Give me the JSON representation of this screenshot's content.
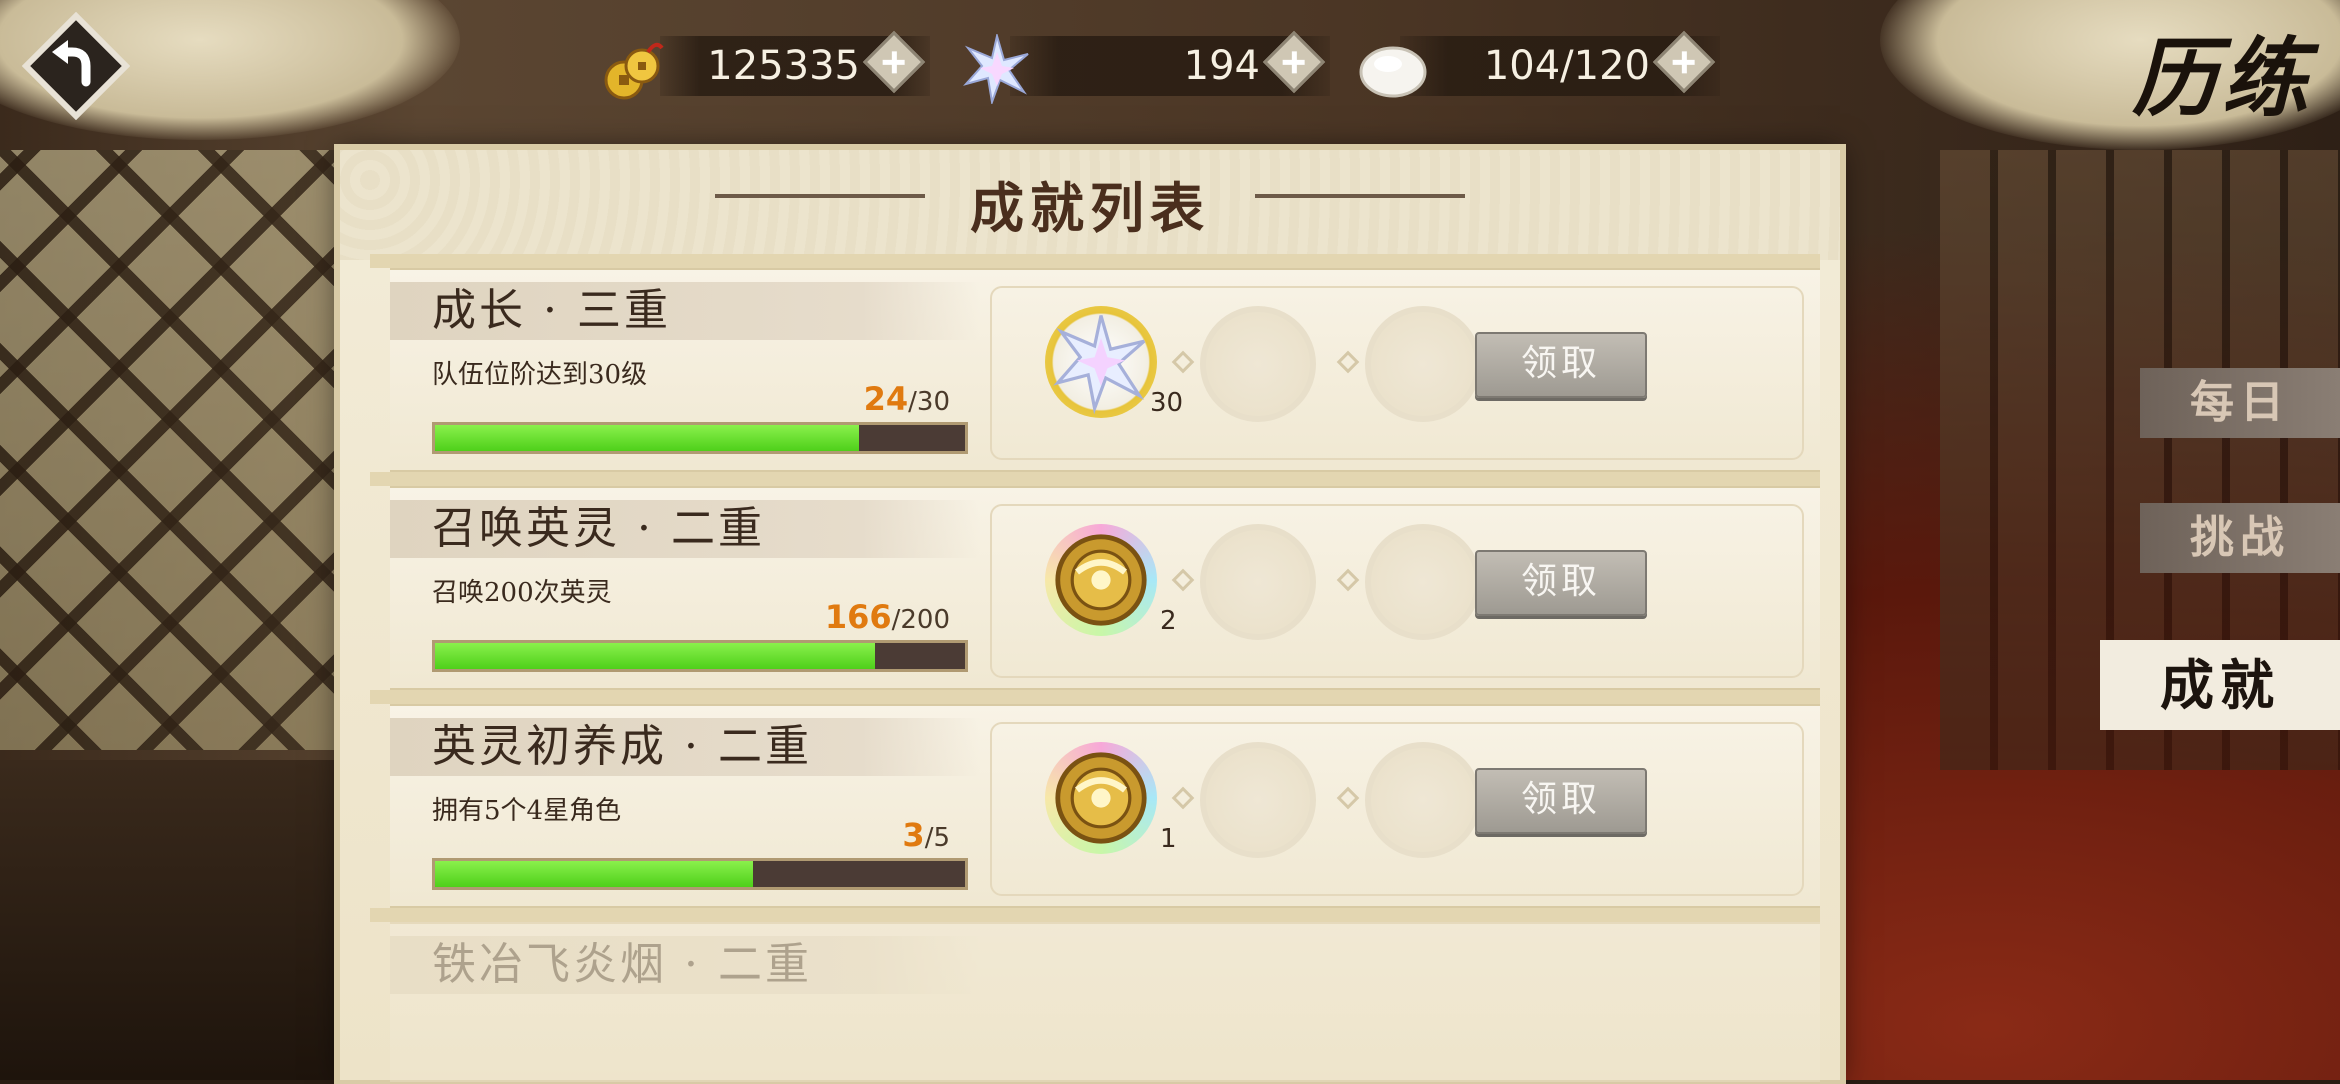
{
  "screen_title": "历练",
  "resources": [
    {
      "name": "copper-coins",
      "value": "125335",
      "icon": "coins-icon"
    },
    {
      "name": "star-gems",
      "value": "194",
      "icon": "crystal-star-icon"
    },
    {
      "name": "stamina",
      "value": "104/120",
      "icon": "rice-cake-icon"
    }
  ],
  "panel_title": "成就列表",
  "achievements": [
    {
      "title": "成长 · 三重",
      "desc": "队伍位阶达到30级",
      "current": "24",
      "total": "/30",
      "progress": 0.8,
      "reward": "crystal-star-icon",
      "reward_count": "30",
      "claim": "领取"
    },
    {
      "title": "召唤英灵 · 二重",
      "desc": "召唤200次英灵",
      "current": "166",
      "total": "/200",
      "progress": 0.83,
      "reward": "gold-medallion-icon",
      "reward_count": "2",
      "claim": "领取"
    },
    {
      "title": "英灵初养成 · 二重",
      "desc": "拥有5个4星角色",
      "current": "3",
      "total": "/5",
      "progress": 0.6,
      "reward": "gold-medallion-icon",
      "reward_count": "1",
      "claim": "领取"
    },
    {
      "title": "铁冶飞炎烟 · 二重"
    }
  ],
  "tabs": [
    "每日",
    "挑战",
    "成就"
  ],
  "active_tab": "成就",
  "colors": {
    "progress_fill": "#4ed01a",
    "accent_orange": "#e07a10",
    "panel": "#f3ecd8"
  }
}
